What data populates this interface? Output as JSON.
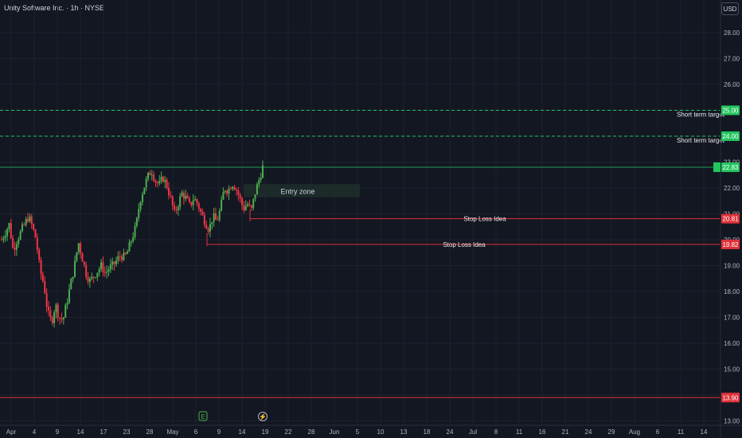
{
  "title": "Unity Software Inc. · 1h · NYSE",
  "currency": "USD",
  "colors": {
    "bg": "#131722",
    "up": "#26a69a",
    "bull": "#4caf50",
    "bear": "#f23645",
    "grid": "#1e222d",
    "target": "#22c55e",
    "stop": "#e0313a"
  },
  "chart_data": {
    "type": "candlestick",
    "y_ticks": [
      "13.00",
      "14.00",
      "15.00",
      "16.00",
      "17.00",
      "18.00",
      "19.00",
      "20.00",
      "21.00",
      "22.00",
      "23.00",
      "24.00",
      "25.00",
      "26.00",
      "27.00",
      "28.00"
    ],
    "ylim": [
      12.8,
      29.4
    ],
    "x_ticks": [
      "Apr",
      "4",
      "9",
      "14",
      "17",
      "23",
      "28",
      "May",
      "6",
      "9",
      "14",
      "19",
      "22",
      "28",
      "Jun",
      "5",
      "10",
      "13",
      "18",
      "24",
      "Jul",
      "8",
      "11",
      "16",
      "21",
      "24",
      "29",
      "Aug",
      "6",
      "11",
      "14"
    ],
    "price_path": [
      20.0,
      20.3,
      20.6,
      19.6,
      20.0,
      20.3,
      20.6,
      20.9,
      20.5,
      20.0,
      18.8,
      18.3,
      17.2,
      16.8,
      17.5,
      17.0,
      16.9,
      17.6,
      18.3,
      19.0,
      19.9,
      19.3,
      18.7,
      18.4,
      18.6,
      18.8,
      19.0,
      18.7,
      18.9,
      19.0,
      19.2,
      19.4,
      19.3,
      19.6,
      20.1,
      20.5,
      21.5,
      22.0,
      22.4,
      22.7,
      22.3,
      22.1,
      22.4,
      22.1,
      21.6,
      21.0,
      21.4,
      21.8,
      21.6,
      21.3,
      21.6,
      21.4,
      21.0,
      20.7,
      20.4,
      20.9,
      20.7,
      21.2,
      22.0,
      21.9,
      22.2,
      22.0,
      21.6,
      21.2,
      21.4,
      21.1,
      21.8,
      22.3,
      22.8
    ],
    "levels": [
      {
        "price": 25.0,
        "label": "Short term target",
        "tag": "25.00",
        "style": "target"
      },
      {
        "price": 24.0,
        "label": "Short term target",
        "tag": "24.00",
        "style": "target"
      },
      {
        "price": 22.8,
        "label": "",
        "tag": "22.83",
        "style": "last"
      },
      {
        "price": 20.81,
        "label": "Stop Loss Idea",
        "tag": "20.81",
        "style": "stop"
      },
      {
        "price": 19.82,
        "label": "Stop Loss Idea",
        "tag": "19.82",
        "style": "stop"
      },
      {
        "price": 13.9,
        "label": "",
        "tag": "13.90",
        "style": "stop"
      }
    ],
    "entry_zone": {
      "label": "Entry zone",
      "price_top": 22.15,
      "price_bottom": 21.7
    },
    "markers": [
      {
        "symbol": "E",
        "near_tick": "6"
      },
      {
        "symbol": "⚡",
        "near_tick": "19"
      }
    ]
  }
}
